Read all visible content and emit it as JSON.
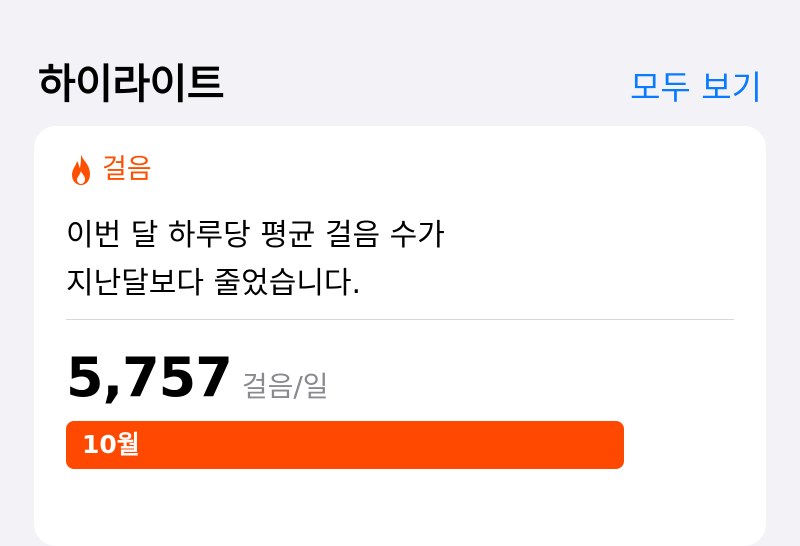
{
  "header": {
    "title": "하이라이트",
    "see_all": "모두 보기"
  },
  "card": {
    "category": "걸음",
    "category_icon": "flame-icon",
    "message_lines": [
      "이번 달 하루당 평균 걸음 수가",
      "지난달보다 줄었습니다."
    ],
    "value": "5,757",
    "unit": "걸음/일",
    "bar": {
      "label": "10월",
      "fill_fraction": 1.0,
      "color": "#ff4800"
    }
  },
  "colors": {
    "accent_link": "#0a7aff",
    "steps_orange": "#ff4f00"
  }
}
